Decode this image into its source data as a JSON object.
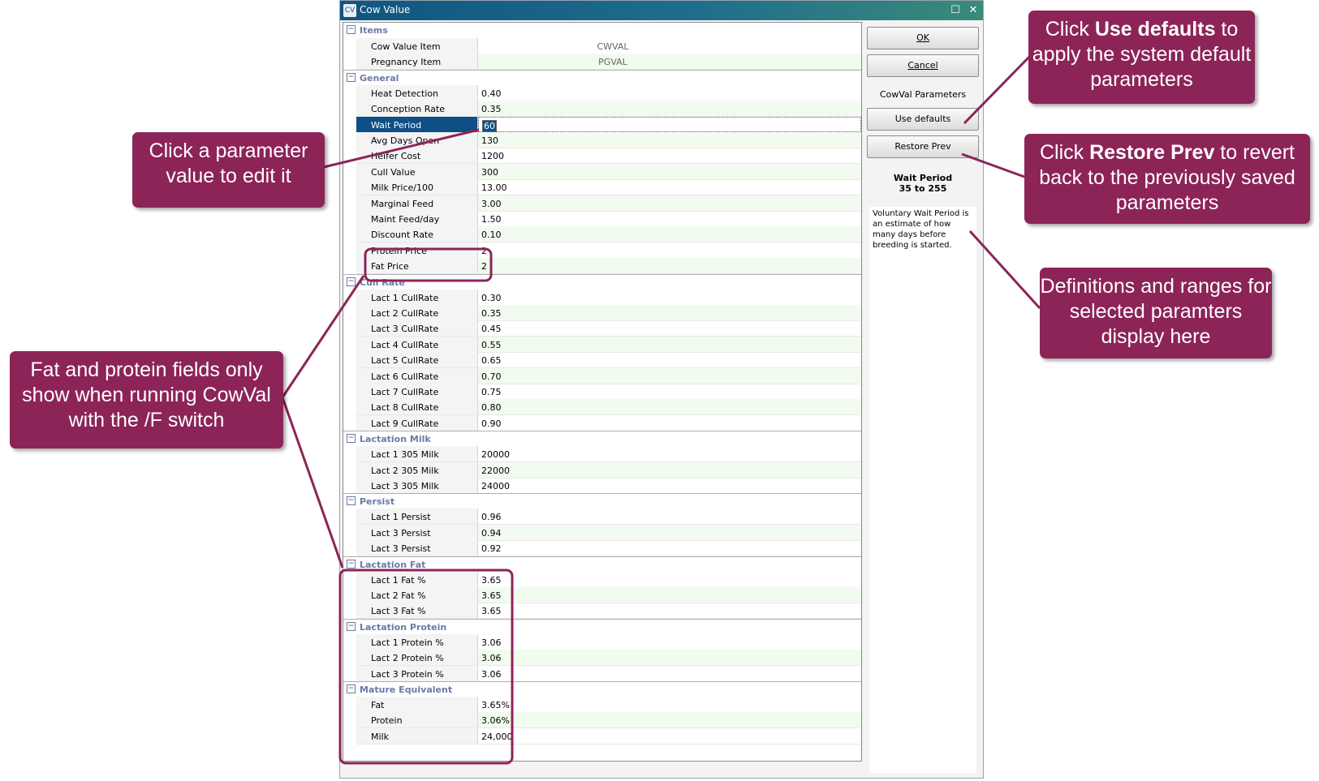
{
  "window": {
    "title": "Cow Value",
    "icon_label": "CV"
  },
  "categories": [
    {
      "name": "Items",
      "rows": [
        {
          "label": "Cow Value Item",
          "value": "CWVAL",
          "readonly": true
        },
        {
          "label": "Pregnancy Item",
          "value": "PGVAL",
          "readonly": true
        }
      ]
    },
    {
      "name": "General",
      "rows": [
        {
          "label": "Heat Detection",
          "value": "0.40"
        },
        {
          "label": "Conception Rate",
          "value": "0.35"
        },
        {
          "label": "Wait Period",
          "value": "60",
          "selected": true
        },
        {
          "label": "Avg Days Open",
          "value": "130"
        },
        {
          "label": "Heifer Cost",
          "value": "1200"
        },
        {
          "label": "Cull Value",
          "value": "300"
        },
        {
          "label": "Milk Price/100",
          "value": "13.00"
        },
        {
          "label": "Marginal Feed",
          "value": "3.00"
        },
        {
          "label": "Maint Feed/day",
          "value": "1.50"
        },
        {
          "label": "Discount Rate",
          "value": "0.10"
        },
        {
          "label": "Protein Price",
          "value": "2"
        },
        {
          "label": "Fat Price",
          "value": "2"
        }
      ]
    },
    {
      "name": "Cull Rate",
      "rows": [
        {
          "label": "Lact 1 CullRate",
          "value": "0.30"
        },
        {
          "label": "Lact 2 CullRate",
          "value": "0.35"
        },
        {
          "label": "Lact 3 CullRate",
          "value": "0.45"
        },
        {
          "label": "Lact 4 CullRate",
          "value": "0.55"
        },
        {
          "label": "Lact 5 CullRate",
          "value": "0.65"
        },
        {
          "label": "Lact 6 CullRate",
          "value": "0.70"
        },
        {
          "label": "Lact 7 CullRate",
          "value": "0.75"
        },
        {
          "label": "Lact 8 CullRate",
          "value": "0.80"
        },
        {
          "label": "Lact 9 CullRate",
          "value": "0.90"
        }
      ]
    },
    {
      "name": "Lactation Milk",
      "rows": [
        {
          "label": "Lact 1 305 Milk",
          "value": "20000"
        },
        {
          "label": "Lact 2 305 Milk",
          "value": "22000"
        },
        {
          "label": "Lact 3 305 Milk",
          "value": "24000"
        }
      ]
    },
    {
      "name": "Persist",
      "rows": [
        {
          "label": "Lact 1 Persist",
          "value": "0.96"
        },
        {
          "label": "Lact 3 Persist",
          "value": "0.94"
        },
        {
          "label": "Lact 3 Persist",
          "value": "0.92"
        }
      ]
    },
    {
      "name": "Lactation Fat",
      "rows": [
        {
          "label": "Lact 1 Fat %",
          "value": "3.65"
        },
        {
          "label": "Lact 2 Fat %",
          "value": "3.65"
        },
        {
          "label": "Lact 3 Fat %",
          "value": "3.65"
        }
      ]
    },
    {
      "name": "Lactation Protein",
      "rows": [
        {
          "label": "Lact 1 Protein %",
          "value": "3.06"
        },
        {
          "label": "Lact 2 Protein %",
          "value": "3.06"
        },
        {
          "label": "Lact 3 Protein %",
          "value": "3.06"
        }
      ]
    },
    {
      "name": "Mature Equivalent",
      "rows": [
        {
          "label": "Fat",
          "value": "3.65%"
        },
        {
          "label": "Protein",
          "value": "3.06%"
        },
        {
          "label": "Milk",
          "value": "24,000"
        }
      ]
    }
  ],
  "buttons": {
    "ok": "OK",
    "cancel": "Cancel",
    "section_label": "CowVal Parameters",
    "use_defaults": "Use defaults",
    "restore_prev": "Restore Prev"
  },
  "selected_param": {
    "name": "Wait Period",
    "range": "35 to 255",
    "description": "Voluntary Wait Period is an estimate of how many days before breeding is started."
  },
  "callouts": {
    "click_param": "Click a parameter value to edit it",
    "fat_protein": "Fat and protein fields only show when running CowVal with the /F switch",
    "use_defaults_pre": "Click ",
    "use_defaults_bold": "Use defaults",
    "use_defaults_post": " to apply the system default parameters",
    "restore_pre": "Click ",
    "restore_bold": "Restore Prev",
    "restore_post": " to revert back to the previously saved parameters",
    "definitions": "Definitions and ranges for selected paramters display here"
  },
  "colors": {
    "callout": "#8c2457",
    "selected_row": "#0e4f86",
    "category_text": "#6b7aa6"
  }
}
